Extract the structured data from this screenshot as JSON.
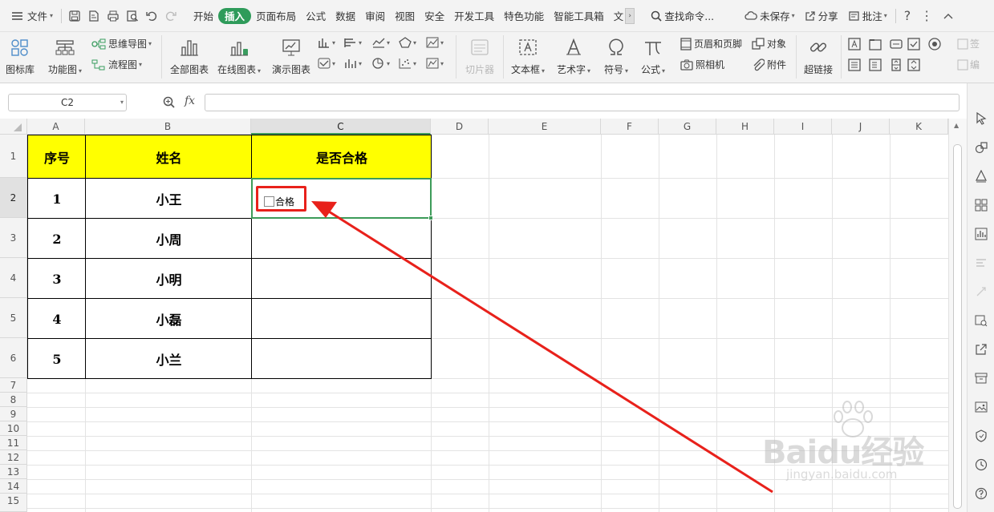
{
  "menubar": {
    "file": "文件",
    "tabs": [
      "开始",
      "插入",
      "页面布局",
      "公式",
      "数据",
      "审阅",
      "视图",
      "安全",
      "开发工具",
      "特色功能",
      "智能工具箱",
      "文"
    ],
    "active_tab_index": 1,
    "search": "查找命令...",
    "unsaved": "未保存",
    "share": "分享",
    "comment": "批注"
  },
  "ribbon": {
    "icon_lib": "图标库",
    "func_chart": "功能图",
    "mind_map": "思维导图",
    "flowchart": "流程图",
    "all_charts": "全部图表",
    "online_charts": "在线图表",
    "demo_charts": "演示图表",
    "slicer": "切片器",
    "textbox": "文本框",
    "wordart": "艺术字",
    "symbol": "符号",
    "formula": "公式",
    "header_footer": "页眉和页脚",
    "camera": "照相机",
    "object": "对象",
    "attachment": "附件",
    "hyperlink": "超链接",
    "sign": "签",
    "edit": "编"
  },
  "formula_bar": {
    "cell_ref": "C2",
    "fx": "fx",
    "content": ""
  },
  "columns": [
    "A",
    "B",
    "C",
    "D",
    "E",
    "F",
    "G",
    "H",
    "I",
    "J",
    "K"
  ],
  "selected_column": "C",
  "rows": [
    "1",
    "2",
    "3",
    "4",
    "5",
    "6",
    "7",
    "8",
    "9",
    "10",
    "11",
    "12",
    "13",
    "14",
    "15"
  ],
  "selected_row": "2",
  "table": {
    "headers": [
      "序号",
      "姓名",
      "是否合格"
    ],
    "rows": [
      {
        "no": "1",
        "name": "小王"
      },
      {
        "no": "2",
        "name": "小周"
      },
      {
        "no": "3",
        "name": "小明"
      },
      {
        "no": "4",
        "name": "小磊"
      },
      {
        "no": "5",
        "name": "小兰"
      }
    ],
    "header_bg": "#ffff00"
  },
  "checkbox": {
    "label": "合格",
    "checked": false
  },
  "annotation_color": "#e8211b",
  "selection_color": "#3d9b59",
  "watermark": {
    "brand": "Baidu经验",
    "url": "jingyan.baidu.com"
  }
}
